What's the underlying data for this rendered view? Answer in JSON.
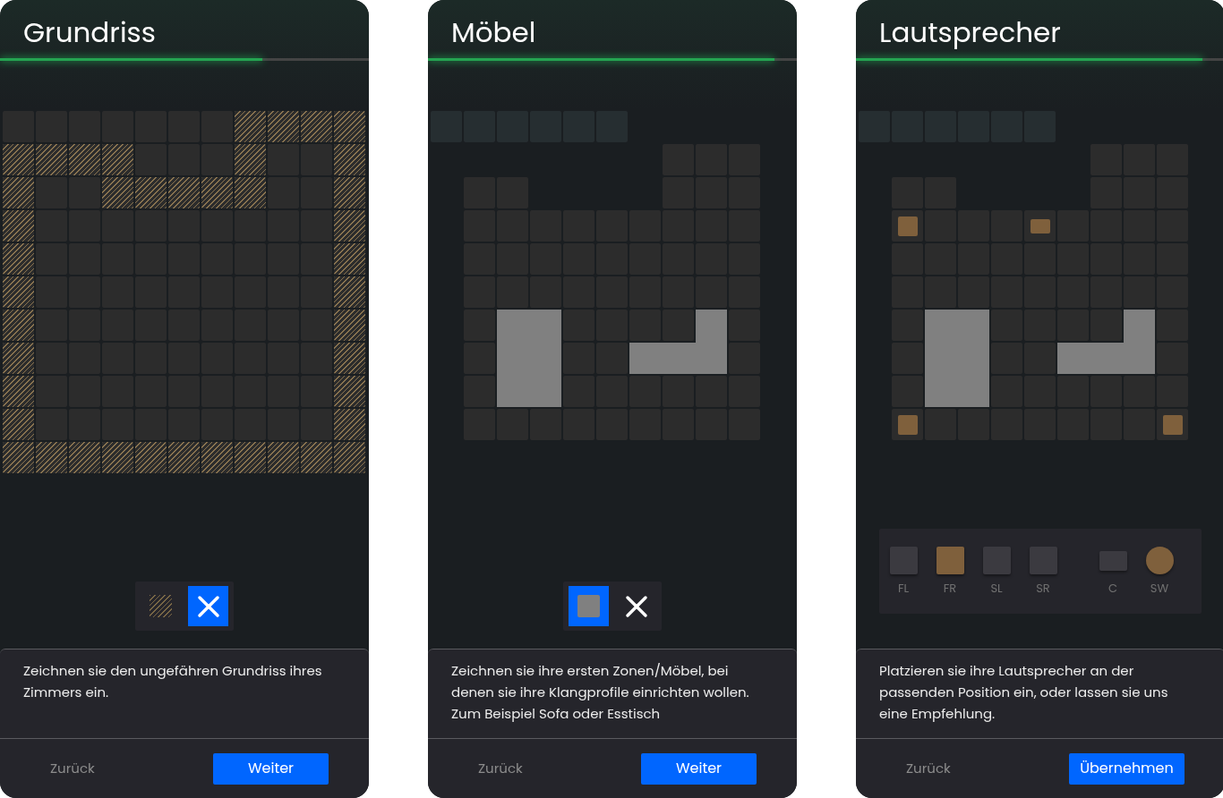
{
  "panels": [
    {
      "title": "Grundriss",
      "progress": {
        "level": 0.71
      },
      "grid": [
        [
          {
            "kind": "floor"
          },
          {
            "kind": "floor"
          },
          {
            "kind": "floor"
          },
          {
            "kind": "floor"
          },
          {
            "kind": "floor"
          },
          {
            "kind": "floor"
          },
          {
            "kind": "floor"
          },
          {
            "kind": "wall"
          },
          {
            "kind": "wall"
          },
          {
            "kind": "wall"
          },
          {
            "kind": "wall"
          }
        ],
        [
          {
            "kind": "wall"
          },
          {
            "kind": "wall"
          },
          {
            "kind": "wall"
          },
          {
            "kind": "wall"
          },
          {
            "kind": "floor"
          },
          {
            "kind": "floor"
          },
          {
            "kind": "floor"
          },
          {
            "kind": "wall"
          },
          {
            "kind": "floor"
          },
          {
            "kind": "floor"
          },
          {
            "kind": "wall"
          }
        ],
        [
          {
            "kind": "wall"
          },
          {
            "kind": "floor"
          },
          {
            "kind": "floor"
          },
          {
            "kind": "wall"
          },
          {
            "kind": "wall"
          },
          {
            "kind": "wall"
          },
          {
            "kind": "wall"
          },
          {
            "kind": "wall"
          },
          {
            "kind": "floor"
          },
          {
            "kind": "floor"
          },
          {
            "kind": "wall"
          }
        ],
        [
          {
            "kind": "wall"
          },
          {
            "kind": "floor"
          },
          {
            "kind": "floor"
          },
          {
            "kind": "floor"
          },
          {
            "kind": "floor"
          },
          {
            "kind": "floor"
          },
          {
            "kind": "floor"
          },
          {
            "kind": "floor"
          },
          {
            "kind": "floor"
          },
          {
            "kind": "floor"
          },
          {
            "kind": "wall"
          }
        ],
        [
          {
            "kind": "wall"
          },
          {
            "kind": "floor"
          },
          {
            "kind": "floor"
          },
          {
            "kind": "floor"
          },
          {
            "kind": "floor"
          },
          {
            "kind": "floor"
          },
          {
            "kind": "floor"
          },
          {
            "kind": "floor"
          },
          {
            "kind": "floor"
          },
          {
            "kind": "floor"
          },
          {
            "kind": "wall"
          }
        ],
        [
          {
            "kind": "wall"
          },
          {
            "kind": "floor"
          },
          {
            "kind": "floor"
          },
          {
            "kind": "floor"
          },
          {
            "kind": "floor"
          },
          {
            "kind": "floor"
          },
          {
            "kind": "floor"
          },
          {
            "kind": "floor"
          },
          {
            "kind": "floor"
          },
          {
            "kind": "floor"
          },
          {
            "kind": "wall"
          }
        ],
        [
          {
            "kind": "wall"
          },
          {
            "kind": "floor"
          },
          {
            "kind": "floor"
          },
          {
            "kind": "floor"
          },
          {
            "kind": "floor"
          },
          {
            "kind": "floor"
          },
          {
            "kind": "floor"
          },
          {
            "kind": "floor"
          },
          {
            "kind": "floor"
          },
          {
            "kind": "floor"
          },
          {
            "kind": "wall"
          }
        ],
        [
          {
            "kind": "wall"
          },
          {
            "kind": "floor"
          },
          {
            "kind": "floor"
          },
          {
            "kind": "floor"
          },
          {
            "kind": "floor"
          },
          {
            "kind": "floor"
          },
          {
            "kind": "floor"
          },
          {
            "kind": "floor"
          },
          {
            "kind": "floor"
          },
          {
            "kind": "floor"
          },
          {
            "kind": "wall"
          }
        ],
        [
          {
            "kind": "wall"
          },
          {
            "kind": "floor"
          },
          {
            "kind": "floor"
          },
          {
            "kind": "floor"
          },
          {
            "kind": "floor"
          },
          {
            "kind": "floor"
          },
          {
            "kind": "floor"
          },
          {
            "kind": "floor"
          },
          {
            "kind": "floor"
          },
          {
            "kind": "floor"
          },
          {
            "kind": "wall"
          }
        ],
        [
          {
            "kind": "wall"
          },
          {
            "kind": "floor"
          },
          {
            "kind": "floor"
          },
          {
            "kind": "floor"
          },
          {
            "kind": "floor"
          },
          {
            "kind": "floor"
          },
          {
            "kind": "floor"
          },
          {
            "kind": "floor"
          },
          {
            "kind": "floor"
          },
          {
            "kind": "floor"
          },
          {
            "kind": "wall"
          }
        ],
        [
          {
            "kind": "wall"
          },
          {
            "kind": "wall"
          },
          {
            "kind": "wall"
          },
          {
            "kind": "wall"
          },
          {
            "kind": "wall"
          },
          {
            "kind": "wall"
          },
          {
            "kind": "wall"
          },
          {
            "kind": "wall"
          },
          {
            "kind": "wall"
          },
          {
            "kind": "wall"
          },
          {
            "kind": "wall"
          }
        ]
      ],
      "tools": [
        {
          "kind": "hatch",
          "selected": false
        },
        {
          "kind": "cross",
          "selected": true
        }
      ],
      "description": "Zeichnen sie den ungefähren Grundriss ihres Zimmers ein.",
      "back": "Zurück",
      "next": "Weiter"
    },
    {
      "title": "Möbel",
      "progress": {
        "level": 0.94
      },
      "grid": [
        [
          {
            "kind": "faded"
          },
          {
            "kind": "faded"
          },
          {
            "kind": "faded"
          },
          {
            "kind": "faded"
          },
          {
            "kind": "faded"
          },
          {
            "kind": "faded"
          },
          {
            "kind": "empty"
          },
          {
            "kind": "empty"
          },
          {
            "kind": "empty"
          },
          {
            "kind": "empty"
          },
          {
            "kind": "empty"
          }
        ],
        [
          {
            "kind": "empty"
          },
          {
            "kind": "empty"
          },
          {
            "kind": "empty"
          },
          {
            "kind": "empty"
          },
          {
            "kind": "empty"
          },
          {
            "kind": "empty"
          },
          {
            "kind": "empty"
          },
          {
            "kind": "floor"
          },
          {
            "kind": "floor"
          },
          {
            "kind": "floor"
          },
          {
            "kind": "empty"
          }
        ],
        [
          {
            "kind": "empty"
          },
          {
            "kind": "floor"
          },
          {
            "kind": "floor"
          },
          {
            "kind": "empty"
          },
          {
            "kind": "empty"
          },
          {
            "kind": "empty"
          },
          {
            "kind": "empty"
          },
          {
            "kind": "floor"
          },
          {
            "kind": "floor"
          },
          {
            "kind": "floor"
          },
          {
            "kind": "empty"
          }
        ],
        [
          {
            "kind": "empty"
          },
          {
            "kind": "floor"
          },
          {
            "kind": "floor"
          },
          {
            "kind": "floor"
          },
          {
            "kind": "floor"
          },
          {
            "kind": "floor"
          },
          {
            "kind": "floor"
          },
          {
            "kind": "floor"
          },
          {
            "kind": "floor"
          },
          {
            "kind": "floor"
          },
          {
            "kind": "empty"
          }
        ],
        [
          {
            "kind": "empty"
          },
          {
            "kind": "floor"
          },
          {
            "kind": "floor"
          },
          {
            "kind": "floor"
          },
          {
            "kind": "floor"
          },
          {
            "kind": "floor"
          },
          {
            "kind": "floor"
          },
          {
            "kind": "floor"
          },
          {
            "kind": "floor"
          },
          {
            "kind": "floor"
          },
          {
            "kind": "empty"
          }
        ],
        [
          {
            "kind": "empty"
          },
          {
            "kind": "floor"
          },
          {
            "kind": "floor"
          },
          {
            "kind": "floor"
          },
          {
            "kind": "floor"
          },
          {
            "kind": "floor"
          },
          {
            "kind": "floor"
          },
          {
            "kind": "floor"
          },
          {
            "kind": "floor"
          },
          {
            "kind": "floor"
          },
          {
            "kind": "empty"
          }
        ],
        [
          {
            "kind": "empty"
          },
          {
            "kind": "floor"
          },
          {
            "kind": "furniture"
          },
          {
            "kind": "furniture"
          },
          {
            "kind": "floor"
          },
          {
            "kind": "floor"
          },
          {
            "kind": "floor"
          },
          {
            "kind": "floor"
          },
          {
            "kind": "furniture"
          },
          {
            "kind": "floor"
          },
          {
            "kind": "empty"
          }
        ],
        [
          {
            "kind": "empty"
          },
          {
            "kind": "floor"
          },
          {
            "kind": "furniture"
          },
          {
            "kind": "furniture"
          },
          {
            "kind": "floor"
          },
          {
            "kind": "floor"
          },
          {
            "kind": "furniture"
          },
          {
            "kind": "furniture"
          },
          {
            "kind": "furniture"
          },
          {
            "kind": "floor"
          },
          {
            "kind": "empty"
          }
        ],
        [
          {
            "kind": "empty"
          },
          {
            "kind": "floor"
          },
          {
            "kind": "furniture"
          },
          {
            "kind": "furniture"
          },
          {
            "kind": "floor"
          },
          {
            "kind": "floor"
          },
          {
            "kind": "floor"
          },
          {
            "kind": "floor"
          },
          {
            "kind": "floor"
          },
          {
            "kind": "floor"
          },
          {
            "kind": "empty"
          }
        ],
        [
          {
            "kind": "empty"
          },
          {
            "kind": "floor"
          },
          {
            "kind": "floor"
          },
          {
            "kind": "floor"
          },
          {
            "kind": "floor"
          },
          {
            "kind": "floor"
          },
          {
            "kind": "floor"
          },
          {
            "kind": "floor"
          },
          {
            "kind": "floor"
          },
          {
            "kind": "floor"
          },
          {
            "kind": "empty"
          }
        ],
        [
          {
            "kind": "empty"
          },
          {
            "kind": "empty"
          },
          {
            "kind": "empty"
          },
          {
            "kind": "empty"
          },
          {
            "kind": "empty"
          },
          {
            "kind": "empty"
          },
          {
            "kind": "empty"
          },
          {
            "kind": "empty"
          },
          {
            "kind": "empty"
          },
          {
            "kind": "empty"
          },
          {
            "kind": "empty"
          }
        ]
      ],
      "tools": [
        {
          "kind": "block",
          "selected": true
        },
        {
          "kind": "cross",
          "selected": false
        }
      ],
      "description": "Zeichnen sie ihre ersten Zonen/Möbel, bei denen sie ihre Klangprofile einrichten wollen.\nZum Beispiel Sofa oder Esstisch",
      "back": "Zurück",
      "next": "Weiter"
    },
    {
      "title": "Lautsprecher",
      "progress": {
        "level": 0.94
      },
      "grid": [
        [
          {
            "kind": "faded"
          },
          {
            "kind": "faded"
          },
          {
            "kind": "faded"
          },
          {
            "kind": "faded"
          },
          {
            "kind": "faded"
          },
          {
            "kind": "faded"
          },
          {
            "kind": "empty"
          },
          {
            "kind": "empty"
          },
          {
            "kind": "empty"
          },
          {
            "kind": "empty"
          },
          {
            "kind": "empty"
          }
        ],
        [
          {
            "kind": "empty"
          },
          {
            "kind": "empty"
          },
          {
            "kind": "empty"
          },
          {
            "kind": "empty"
          },
          {
            "kind": "empty"
          },
          {
            "kind": "empty"
          },
          {
            "kind": "empty"
          },
          {
            "kind": "floor"
          },
          {
            "kind": "floor"
          },
          {
            "kind": "floor"
          },
          {
            "kind": "empty"
          }
        ],
        [
          {
            "kind": "empty"
          },
          {
            "kind": "floor"
          },
          {
            "kind": "floor"
          },
          {
            "kind": "empty"
          },
          {
            "kind": "empty"
          },
          {
            "kind": "empty"
          },
          {
            "kind": "empty"
          },
          {
            "kind": "floor"
          },
          {
            "kind": "floor"
          },
          {
            "kind": "floor"
          },
          {
            "kind": "empty"
          }
        ],
        [
          {
            "kind": "empty"
          },
          {
            "kind": "speaker"
          },
          {
            "kind": "floor"
          },
          {
            "kind": "floor"
          },
          {
            "kind": "floor"
          },
          {
            "kind": "center"
          },
          {
            "kind": "floor"
          },
          {
            "kind": "floor"
          },
          {
            "kind": "floor"
          },
          {
            "kind": "floor"
          },
          {
            "kind": "empty"
          }
        ],
        [
          {
            "kind": "empty"
          },
          {
            "kind": "floor"
          },
          {
            "kind": "floor"
          },
          {
            "kind": "floor"
          },
          {
            "kind": "floor"
          },
          {
            "kind": "floor"
          },
          {
            "kind": "floor"
          },
          {
            "kind": "floor"
          },
          {
            "kind": "floor"
          },
          {
            "kind": "floor"
          },
          {
            "kind": "empty"
          }
        ],
        [
          {
            "kind": "empty"
          },
          {
            "kind": "floor"
          },
          {
            "kind": "floor"
          },
          {
            "kind": "floor"
          },
          {
            "kind": "floor"
          },
          {
            "kind": "floor"
          },
          {
            "kind": "floor"
          },
          {
            "kind": "floor"
          },
          {
            "kind": "floor"
          },
          {
            "kind": "floor"
          },
          {
            "kind": "empty"
          }
        ],
        [
          {
            "kind": "empty"
          },
          {
            "kind": "floor"
          },
          {
            "kind": "furniture"
          },
          {
            "kind": "furniture"
          },
          {
            "kind": "floor"
          },
          {
            "kind": "floor"
          },
          {
            "kind": "floor"
          },
          {
            "kind": "floor"
          },
          {
            "kind": "furniture"
          },
          {
            "kind": "floor"
          },
          {
            "kind": "empty"
          }
        ],
        [
          {
            "kind": "empty"
          },
          {
            "kind": "floor"
          },
          {
            "kind": "furniture"
          },
          {
            "kind": "furniture"
          },
          {
            "kind": "floor"
          },
          {
            "kind": "floor"
          },
          {
            "kind": "furniture"
          },
          {
            "kind": "furniture"
          },
          {
            "kind": "furniture"
          },
          {
            "kind": "floor"
          },
          {
            "kind": "empty"
          }
        ],
        [
          {
            "kind": "empty"
          },
          {
            "kind": "floor"
          },
          {
            "kind": "furniture"
          },
          {
            "kind": "furniture"
          },
          {
            "kind": "floor"
          },
          {
            "kind": "floor"
          },
          {
            "kind": "floor"
          },
          {
            "kind": "floor"
          },
          {
            "kind": "floor"
          },
          {
            "kind": "floor"
          },
          {
            "kind": "empty"
          }
        ],
        [
          {
            "kind": "empty"
          },
          {
            "kind": "speaker"
          },
          {
            "kind": "floor"
          },
          {
            "kind": "floor"
          },
          {
            "kind": "floor"
          },
          {
            "kind": "floor"
          },
          {
            "kind": "floor"
          },
          {
            "kind": "floor"
          },
          {
            "kind": "floor"
          },
          {
            "kind": "speaker"
          },
          {
            "kind": "empty"
          }
        ],
        [
          {
            "kind": "empty"
          },
          {
            "kind": "empty"
          },
          {
            "kind": "empty"
          },
          {
            "kind": "empty"
          },
          {
            "kind": "empty"
          },
          {
            "kind": "empty"
          },
          {
            "kind": "empty"
          },
          {
            "kind": "empty"
          },
          {
            "kind": "empty"
          },
          {
            "kind": "empty"
          },
          {
            "kind": "empty"
          }
        ]
      ],
      "palette": [
        [
          {
            "label": "FL",
            "kind": "square",
            "active": false
          },
          {
            "label": "FR",
            "kind": "square",
            "active": true
          },
          {
            "label": "SL",
            "kind": "square",
            "active": false
          },
          {
            "label": "SR",
            "kind": "square",
            "active": false
          }
        ],
        [
          {
            "label": "C",
            "kind": "wide",
            "active": false
          },
          {
            "label": "SW",
            "kind": "circle",
            "active": true
          }
        ]
      ],
      "description": "Platzieren sie ihre Lautsprecher an der passenden Position ein, oder lassen sie uns eine Empfehlung.",
      "back": "Zurück",
      "next": "Übernehmen"
    }
  ]
}
